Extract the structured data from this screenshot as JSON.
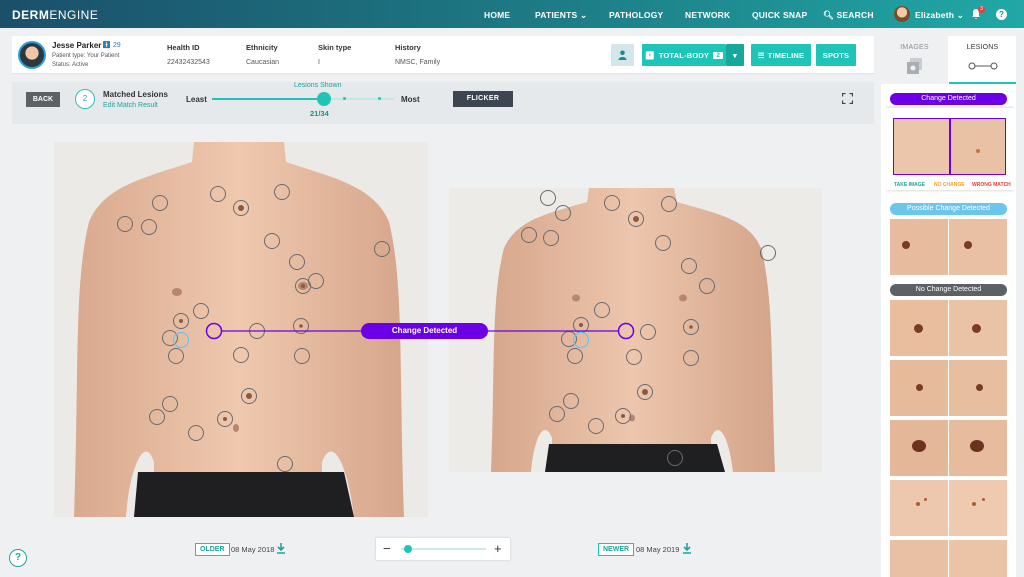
{
  "nav": {
    "logo_bold": "DERM",
    "logo_light": "ENGINE",
    "items": [
      "HOME",
      "PATIENTS",
      "PATHOLOGY",
      "NETWORK",
      "QUICK SNAP",
      "SEARCH"
    ],
    "user": "Elizabeth",
    "notif_count": "3",
    "help": "?"
  },
  "patient": {
    "name": "Jesse Parker",
    "age": "29",
    "type_line": "Patient type: Your Patient",
    "status_line": "Status: Active",
    "columns": [
      {
        "label": "Health ID",
        "value": "22432432543"
      },
      {
        "label": "Ethnicity",
        "value": "Caucasian"
      },
      {
        "label": "Skin type",
        "value": "I"
      },
      {
        "label": "History",
        "value": "NMSC, Family"
      }
    ]
  },
  "toolbar": {
    "total_body_label": "TOTAL-BODY",
    "total_body_count": "2",
    "timeline_label": "TIMELINE",
    "spots_label": "SPOTS"
  },
  "controls": {
    "back_label": "BACK",
    "matched_count": "2",
    "matched_label": "Matched Lesions",
    "edit_link": "Edit Match Result",
    "least_label": "Least",
    "most_label": "Most",
    "lesions_shown_label": "Lesions Shown",
    "lesions_shown_value": "21/34",
    "lesions_shown_fraction": 0.618,
    "flicker_label": "FLICKER"
  },
  "comparison": {
    "change_label": "Change Detected",
    "older_tag": "OLDER",
    "older_date": "08 May 2018",
    "newer_tag": "NEWER",
    "newer_date": "08 May 2019",
    "zoom_fraction": 0.04
  },
  "sidepanel": {
    "tab_images": "IMAGES",
    "tab_lesions": "LESIONS",
    "sections": {
      "changed": "Change Detected",
      "possible": "Possible Change Detected",
      "none": "No Change Detected"
    },
    "actions": {
      "take_image": "TAKE IMAGE",
      "no_change": "NO CHANGE",
      "wrong_match": "WRONG MATCH"
    }
  },
  "colors": {
    "accent": "#1ec4b8",
    "change": "#6b00e6",
    "possible": "#6cc5ea",
    "none": "#5c6166"
  }
}
